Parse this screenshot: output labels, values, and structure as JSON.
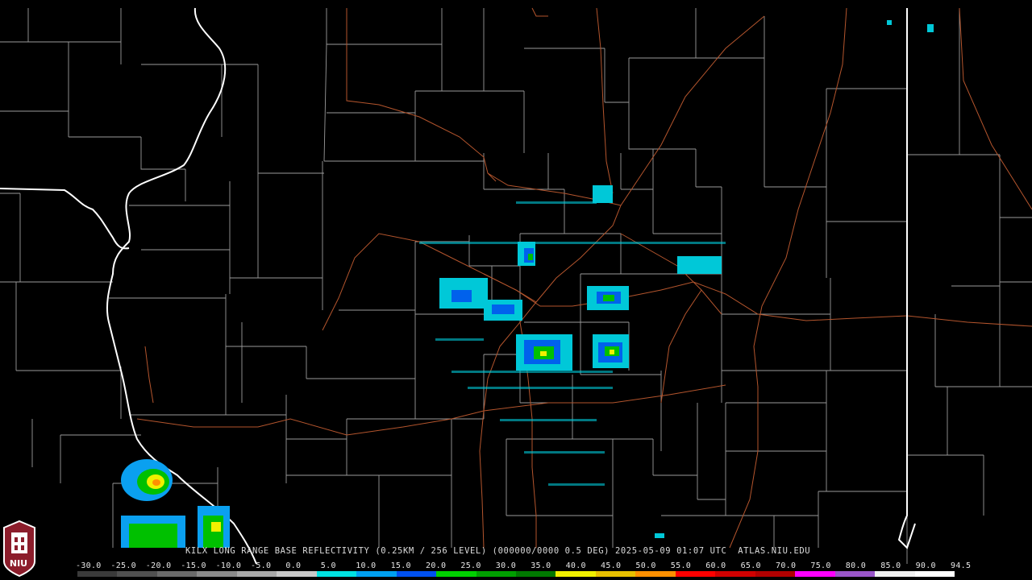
{
  "caption": "KILX LONG RANGE BASE REFLECTIVITY (0.25KM / 256 LEVEL) (000000/0000 0.5 DEG) 2025-05-09 01:07 UTC  ATLAS.NIU.EDU",
  "logo_text": "NIU",
  "legend": {
    "labels": [
      "-30.0",
      "-25.0",
      "-20.0",
      "-15.0",
      "-10.0",
      "-5.0",
      "0.0",
      "5.0",
      "10.0",
      "15.0",
      "20.0",
      "25.0",
      "30.0",
      "35.0",
      "40.0",
      "45.0",
      "50.0",
      "55.0",
      "60.0",
      "65.0",
      "70.0",
      "75.0",
      "80.0",
      "85.0",
      "90.0",
      "94.5"
    ],
    "colors": [
      "#3a3a3a",
      "#505050",
      "#6a6a6a",
      "#8a8a8a",
      "#a8a8a8",
      "#c8c8c8",
      "#00e0e0",
      "#00a0f0",
      "#0050f0",
      "#00d000",
      "#00a000",
      "#007800",
      "#f0f000",
      "#e8c000",
      "#ff9000",
      "#ff0000",
      "#d00000",
      "#b00000",
      "#ff00ff",
      "#9955c9",
      "#f0f0f0",
      "#ffffff"
    ]
  },
  "colors": {
    "background": "#000000",
    "county_lines": "#9a9a9a",
    "state_lines": "#ffffff",
    "roads": "#b4552d"
  }
}
